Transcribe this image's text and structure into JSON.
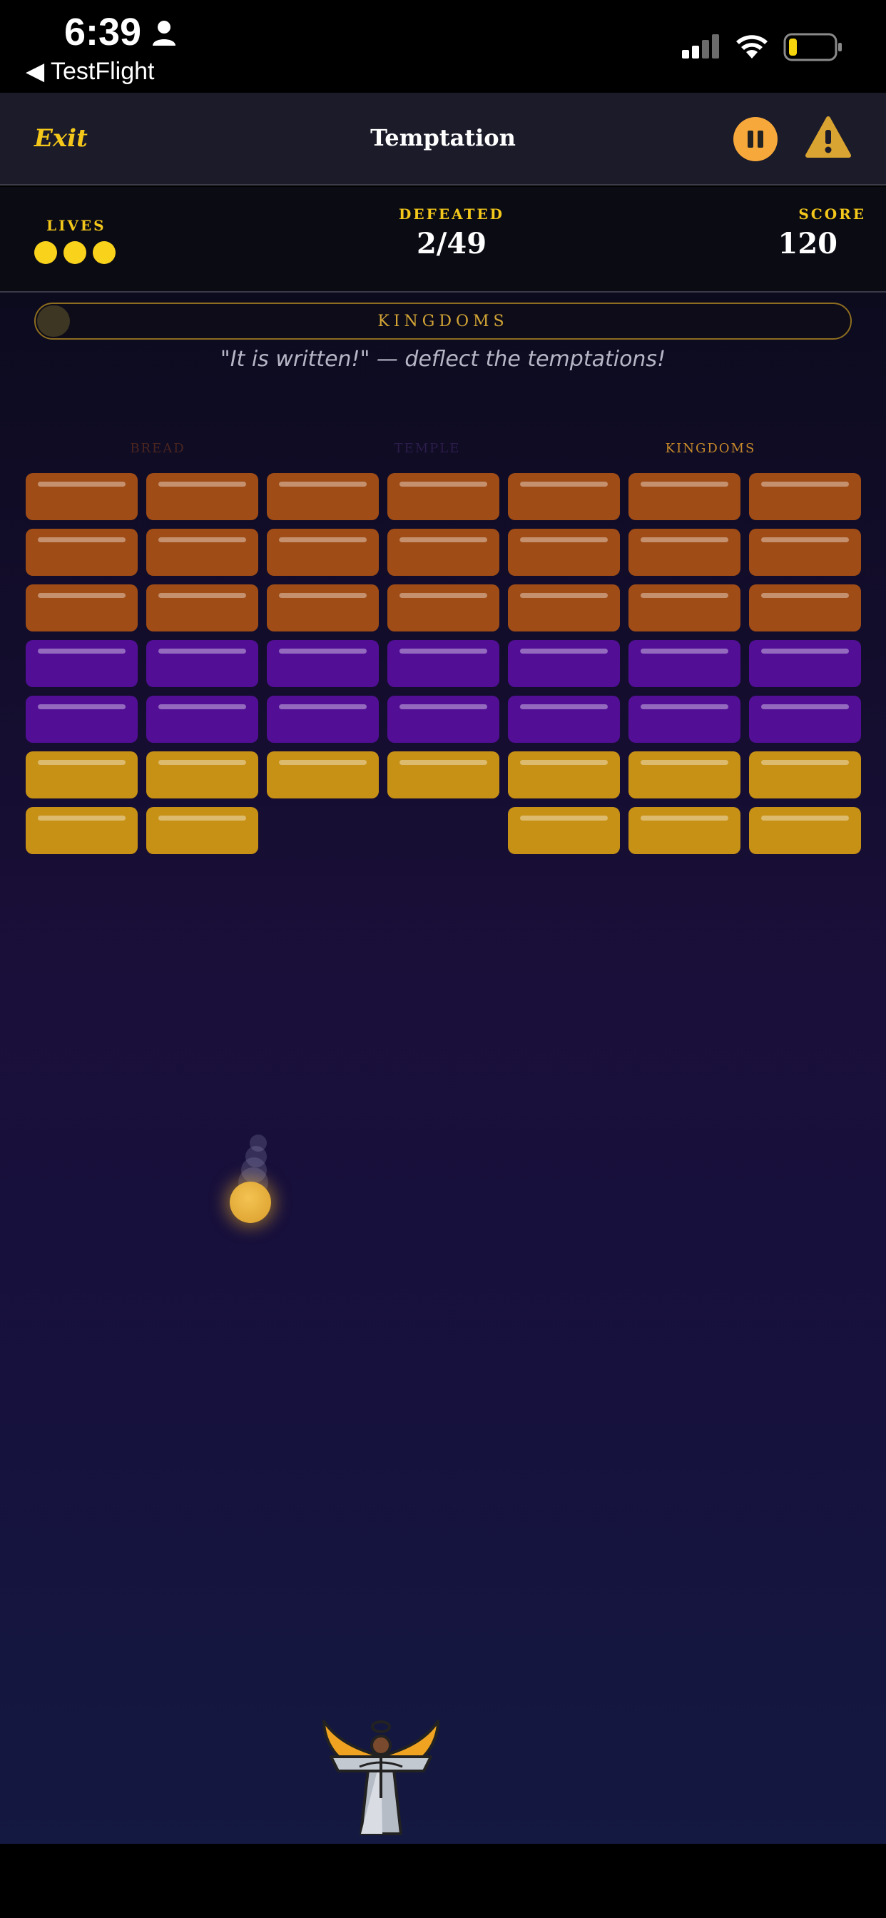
{
  "status_bar": {
    "time": "6:39",
    "back_app": "TestFlight",
    "back_arrow": "◀",
    "icons": [
      "person-icon",
      "cellular-signal-icon",
      "wifi-icon",
      "battery-low-icon"
    ],
    "battery_level": 0.15,
    "battery_color": "#f6d50d"
  },
  "header": {
    "exit_label": "Exit",
    "title": "Temptation",
    "pause_icon": "pause-icon",
    "warning_icon": "warning-icon",
    "accent": "#f7a83a"
  },
  "stats": {
    "lives_label": "LIVES",
    "lives": 3,
    "defeated_label": "DEFEATED",
    "defeated_value": "2/49",
    "score_label": "SCORE",
    "score_value": "120"
  },
  "level": {
    "progress_label": "KINGDOMS",
    "progress_fraction": 0.04,
    "subtitle": "\"It is written!\" — deflect the temptations!",
    "sections": [
      "BREAD",
      "TEMPLE",
      "KINGDOMS"
    ]
  },
  "bricks": {
    "columns": 7,
    "rows": [
      {
        "color": "orange",
        "present": [
          1,
          1,
          1,
          1,
          1,
          1,
          1
        ]
      },
      {
        "color": "orange",
        "present": [
          1,
          1,
          1,
          1,
          1,
          1,
          1
        ]
      },
      {
        "color": "orange",
        "present": [
          1,
          1,
          1,
          1,
          1,
          1,
          1
        ]
      },
      {
        "color": "purple",
        "present": [
          1,
          1,
          1,
          1,
          1,
          1,
          1
        ]
      },
      {
        "color": "purple",
        "present": [
          1,
          1,
          1,
          1,
          1,
          1,
          1
        ]
      },
      {
        "color": "gold",
        "present": [
          1,
          1,
          1,
          1,
          1,
          1,
          1
        ]
      },
      {
        "color": "gold",
        "present": [
          1,
          1,
          0,
          0,
          1,
          1,
          1
        ]
      }
    ],
    "colors": {
      "orange": "#a04c16",
      "purple": "#520f96",
      "gold": "#c79116"
    }
  },
  "paddle": {
    "icon": "angel-paddle-icon"
  },
  "ball": {
    "icon": "ball-icon",
    "color": "#f4c352"
  }
}
